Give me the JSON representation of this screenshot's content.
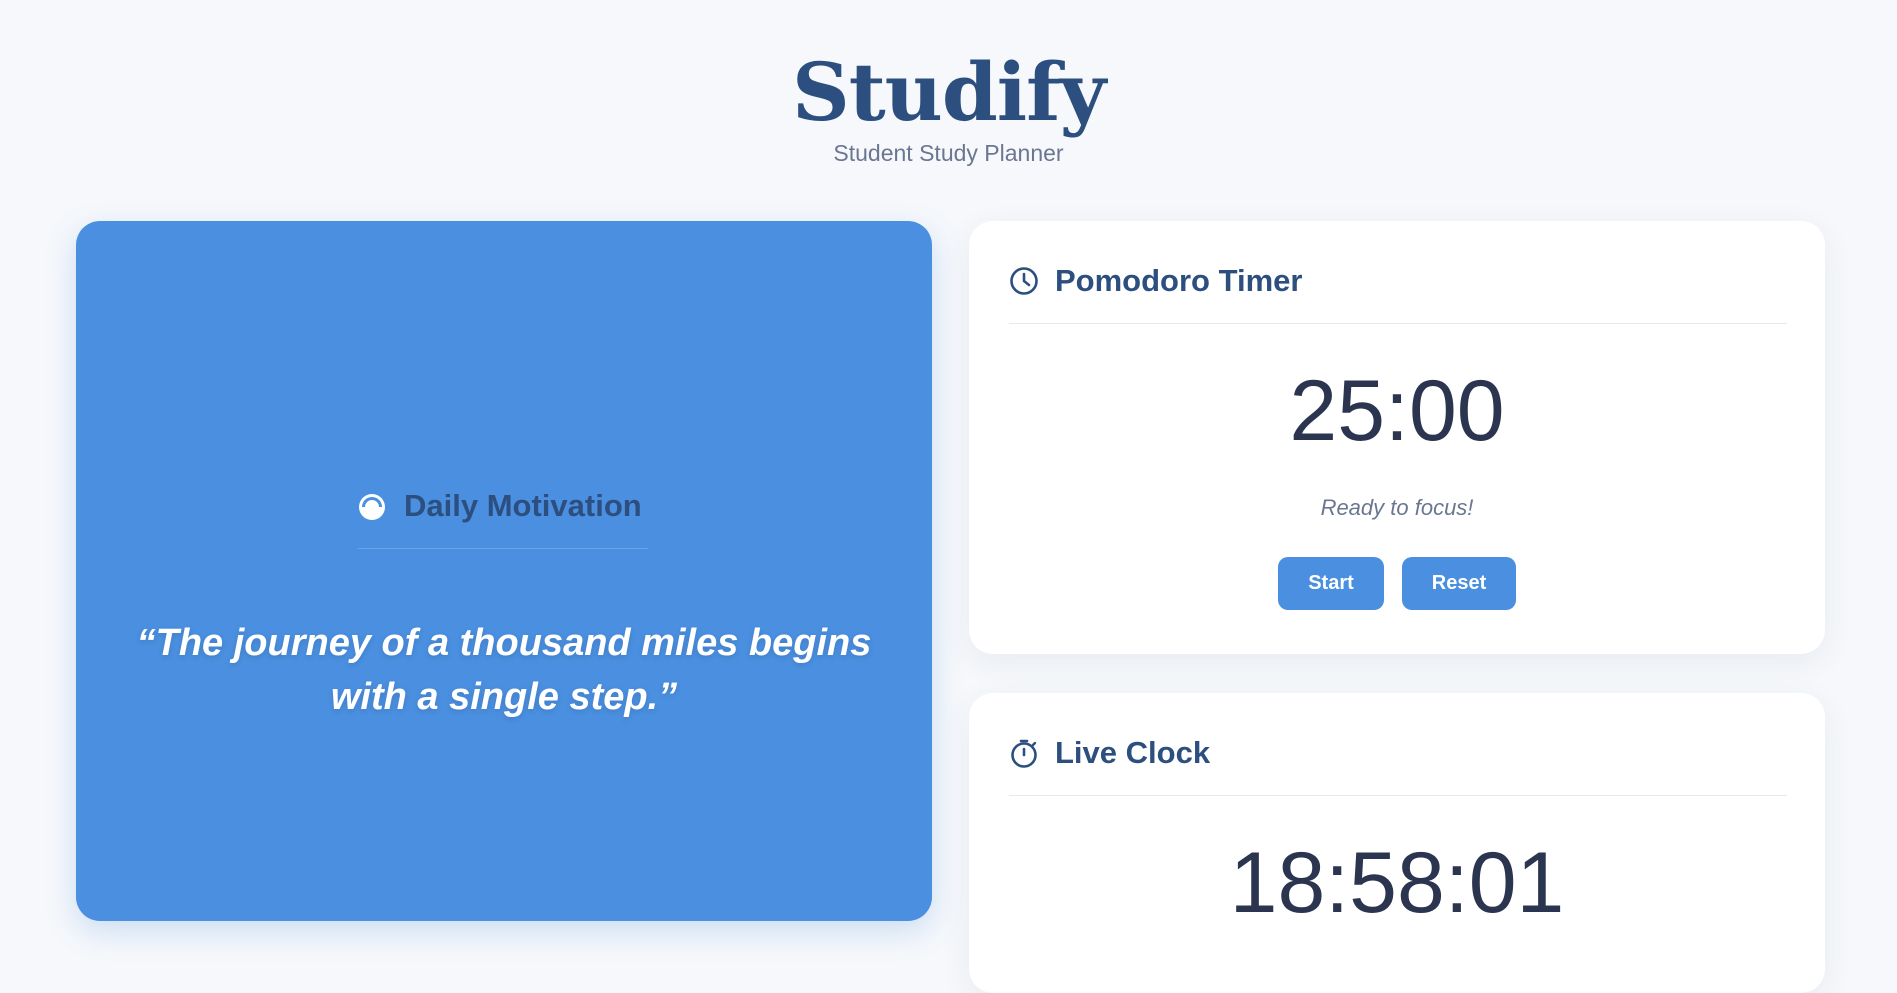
{
  "header": {
    "title": "Studify",
    "subtitle": "Student Study Planner"
  },
  "motivation": {
    "title": "Daily Motivation",
    "icon": "sunrise-icon",
    "quote": "“The journey of a thousand miles begins with a single step.”",
    "background_color": "#4a8fe0"
  },
  "timer": {
    "title": "Pomodoro Timer",
    "icon": "clock-icon",
    "display": "25:00",
    "status": "Ready to focus!",
    "start_label": "Start",
    "reset_label": "Reset"
  },
  "clock": {
    "title": "Live Clock",
    "icon": "stopwatch-icon",
    "display": "18:58:01"
  },
  "colors": {
    "accent": "#4a8fe0",
    "heading": "#2c4f7f",
    "background": "#f6f8fb"
  }
}
